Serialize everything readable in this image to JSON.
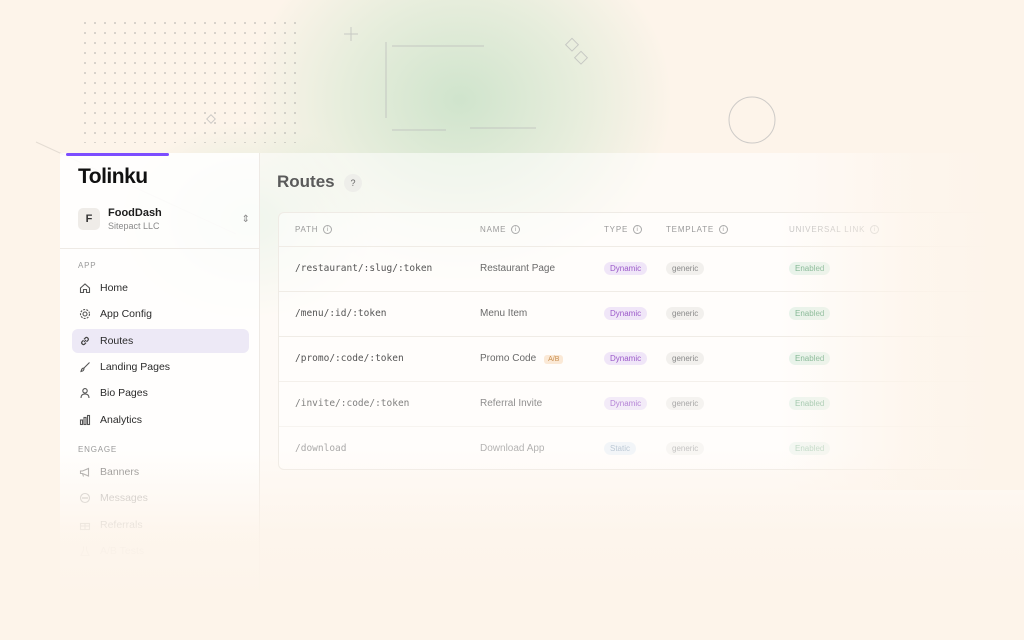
{
  "app": {
    "logo": "Tolinku",
    "workspace": {
      "avatar_letter": "F",
      "name": "FoodDash",
      "org": "Sitepact LLC"
    }
  },
  "sidebar": {
    "sections": [
      {
        "label": "APP"
      },
      {
        "label": "ENGAGE"
      }
    ],
    "items": [
      {
        "label": "Home",
        "icon": "home-icon"
      },
      {
        "label": "App Config",
        "icon": "gear-icon"
      },
      {
        "label": "Routes",
        "icon": "link-icon",
        "active": true
      },
      {
        "label": "Landing Pages",
        "icon": "brush-icon"
      },
      {
        "label": "Bio Pages",
        "icon": "user-icon"
      },
      {
        "label": "Analytics",
        "icon": "bar-chart-icon"
      },
      {
        "label": "Banners",
        "icon": "megaphone-icon"
      },
      {
        "label": "Messages",
        "icon": "chat-icon"
      },
      {
        "label": "Referrals",
        "icon": "gift-icon"
      },
      {
        "label": "A/B Tests",
        "icon": "flask-icon"
      }
    ]
  },
  "main": {
    "title": "Routes",
    "help": "?",
    "columns": [
      "PATH",
      "NAME",
      "TYPE",
      "TEMPLATE",
      "UNIVERSAL LINK"
    ],
    "rows": [
      {
        "path": "/restaurant/:slug/:token",
        "name": "Restaurant Page",
        "badge": "",
        "type": "Dynamic",
        "template": "generic",
        "universal": "Enabled"
      },
      {
        "path": "/menu/:id/:token",
        "name": "Menu Item",
        "badge": "",
        "type": "Dynamic",
        "template": "generic",
        "universal": "Enabled"
      },
      {
        "path": "/promo/:code/:token",
        "name": "Promo Code",
        "badge": "A/B",
        "type": "Dynamic",
        "template": "generic",
        "universal": "Enabled"
      },
      {
        "path": "/invite/:code/:token",
        "name": "Referral Invite",
        "badge": "",
        "type": "Dynamic",
        "template": "generic",
        "universal": "Enabled"
      },
      {
        "path": "/download",
        "name": "Download App",
        "badge": "",
        "type": "Static",
        "template": "generic",
        "universal": "Enabled"
      }
    ]
  },
  "colors": {
    "background": "#fdf4ea",
    "accent": "#7c4dff",
    "dynamic": "#9b59c9",
    "enabled": "#76b08a"
  }
}
